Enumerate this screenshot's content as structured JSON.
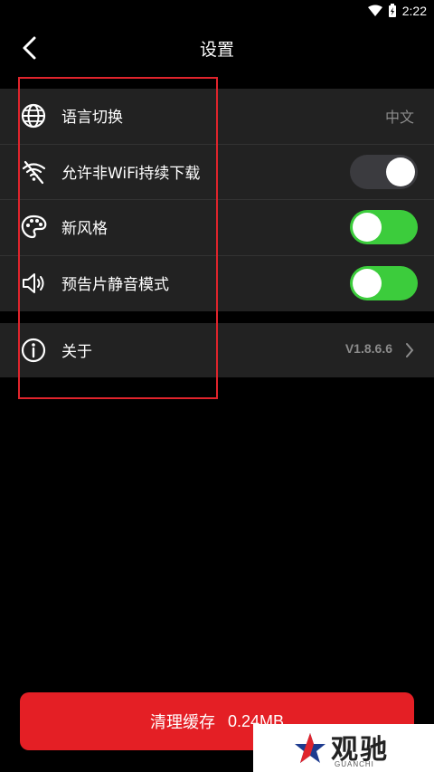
{
  "status_bar": {
    "time": "2:22"
  },
  "header": {
    "title": "设置"
  },
  "settings": {
    "language": {
      "label": "语言切换",
      "value": "中文"
    },
    "non_wifi_download": {
      "label": "允许非WiFi持续下载",
      "enabled": false
    },
    "new_style": {
      "label": "新风格",
      "enabled": true
    },
    "trailer_mute": {
      "label": "预告片静音模式",
      "enabled": true
    },
    "about": {
      "label": "关于",
      "version": "V1.8.6.6"
    }
  },
  "clear_cache": {
    "label": "清理缓存",
    "size": "0.24MB"
  },
  "watermark": {
    "text": "观驰",
    "sub": "GUANCHI"
  },
  "colors": {
    "accent_red": "#e41f25",
    "toggle_on": "#3ccc3c",
    "row_bg": "#222222"
  }
}
